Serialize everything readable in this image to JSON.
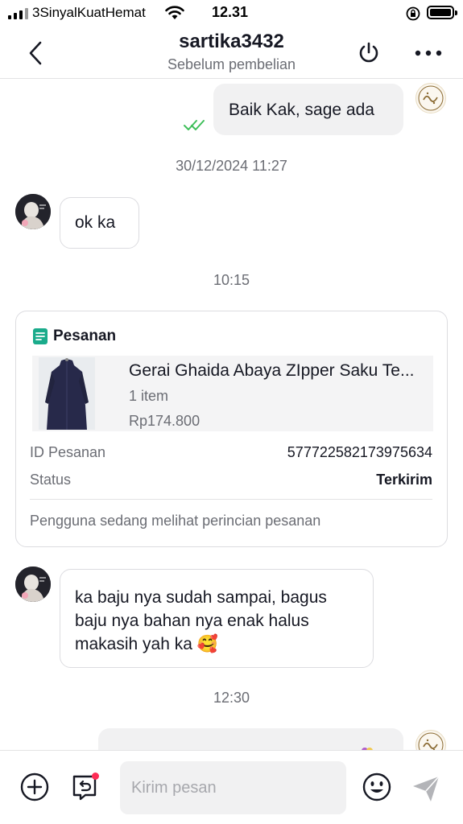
{
  "status_bar": {
    "carrier": "3SinyalKuatHemat",
    "time": "12.31"
  },
  "header": {
    "title": "sartika3432",
    "subtitle": "Sebelum pembelian"
  },
  "messages": {
    "m1": "Baik Kak, sage ada",
    "m2": "ok ka",
    "m3_line1": "ka baju nya sudah sampai, bagus",
    "m3_line2": "baju nya bahan nya enak halus",
    "m3_line3": "makasih yah ka 🥰"
  },
  "timestamps": {
    "t1": "30/12/2024 11:27",
    "t2": "10:15",
    "t3": "12:30"
  },
  "order_card": {
    "title": "Pesanan",
    "product_name": "Gerai Ghaida Abaya ZIpper Saku Te...",
    "quantity": "1 item",
    "price": "Rp174.800",
    "id_label": "ID Pesanan",
    "id_value": "577722582173975634",
    "status_label": "Status",
    "status_value": "Terkirim",
    "note": "Pengguna sedang melihat perincian pesanan"
  },
  "composer": {
    "placeholder": "Kirim pesan"
  },
  "colors": {
    "check": "#3fbf5a",
    "notification_dot": "#fe2c55",
    "order_icon": "#1aab8b"
  },
  "icons": [
    "back-icon",
    "power-icon",
    "more-icon",
    "read-check-icon",
    "order-doc-icon",
    "plus-icon",
    "return-icon",
    "emoji-icon",
    "send-icon"
  ]
}
